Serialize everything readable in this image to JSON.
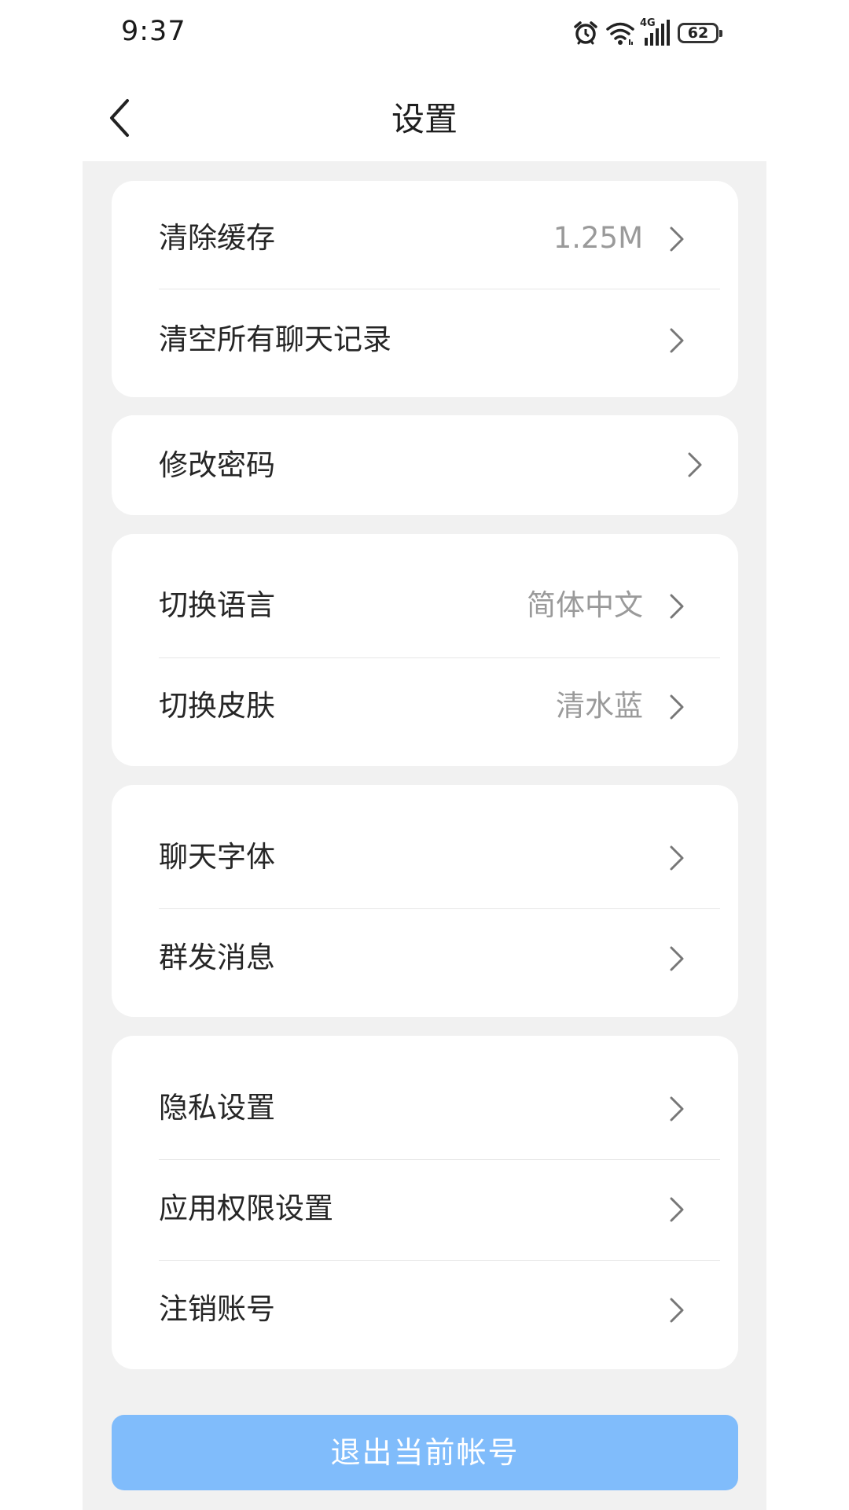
{
  "status_bar": {
    "time": "9:37",
    "network_label": "4G",
    "battery_level": "62",
    "icons": [
      "alarm-icon",
      "wifi-icon",
      "signal-icon",
      "battery-icon"
    ]
  },
  "header": {
    "title": "设置",
    "back_icon": "back-arrow-icon"
  },
  "sections": [
    {
      "items": [
        {
          "label": "清除缓存",
          "value": "1.25M"
        },
        {
          "label": "清空所有聊天记录",
          "value": ""
        }
      ]
    },
    {
      "items": [
        {
          "label": "修改密码",
          "value": ""
        }
      ]
    },
    {
      "items": [
        {
          "label": "切换语言",
          "value": "简体中文"
        },
        {
          "label": "切换皮肤",
          "value": "清水蓝"
        }
      ]
    },
    {
      "items": [
        {
          "label": "聊天字体",
          "value": ""
        },
        {
          "label": "群发消息",
          "value": ""
        }
      ]
    },
    {
      "items": [
        {
          "label": "隐私设置",
          "value": ""
        },
        {
          "label": "应用权限设置",
          "value": ""
        },
        {
          "label": "注销账号",
          "value": ""
        }
      ]
    }
  ],
  "logout_button": {
    "label": "退出当前帐号"
  },
  "colors": {
    "background": "#f1f1f1",
    "card": "#ffffff",
    "accent": "#80bcfb",
    "value_text": "#9a9a9a"
  }
}
